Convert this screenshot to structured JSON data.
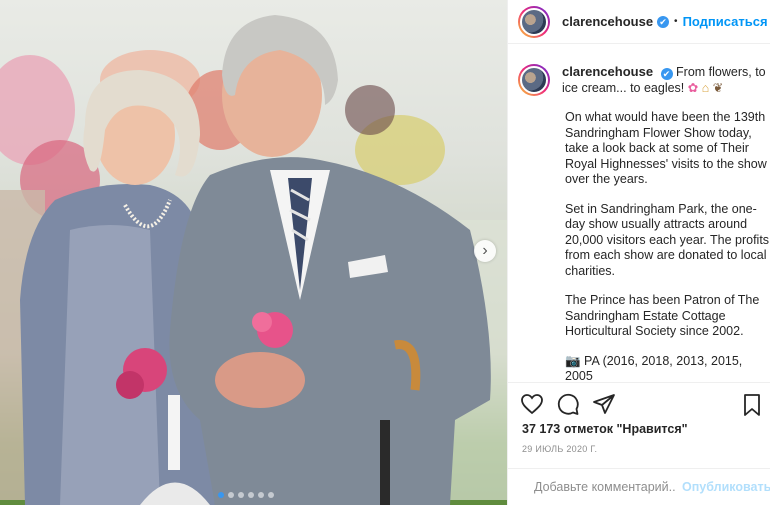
{
  "post": {
    "image_alt": "",
    "carousel": {
      "dot_count": 6,
      "active_index": 0
    }
  },
  "header": {
    "username": "clarencehouse",
    "verified": "✔",
    "bullet": "•",
    "follow_label": "Подписаться"
  },
  "caption": {
    "username": "clarencehouse",
    "first_line": "From flowers, to ice cream... to eagles!",
    "emoji_flower": "✿",
    "emoji_ice": "⌂",
    "emoji_eagle": "❦",
    "paragraphs": [
      "On what would have been the 139th Sandringham Flower Show today, take a look back at some of Their Royal Highnesses' visits to the show over the years.",
      "Set in Sandringham Park, the one-day show usually attracts around 20,000 visitors each year. The profits from each show are donated to local charities.",
      "The Prince has been Patron of The Sandringham Estate Cottage Horticultural Society since 2002.",
      "📷 PA (2016, 2018, 2013, 2015, 2005"
    ]
  },
  "engagement": {
    "likes_text": "37 173 отметок \"Нравится\"",
    "date_text": "29 ИЮЛЬ 2020 Г."
  },
  "comment_box": {
    "placeholder": "Добавьте комментарий...",
    "publish_label": "Опубликовать"
  },
  "colors": {
    "link_blue": "#0095f6",
    "verified_blue": "#3897f0",
    "publish_disabled": "#b2dffc"
  }
}
